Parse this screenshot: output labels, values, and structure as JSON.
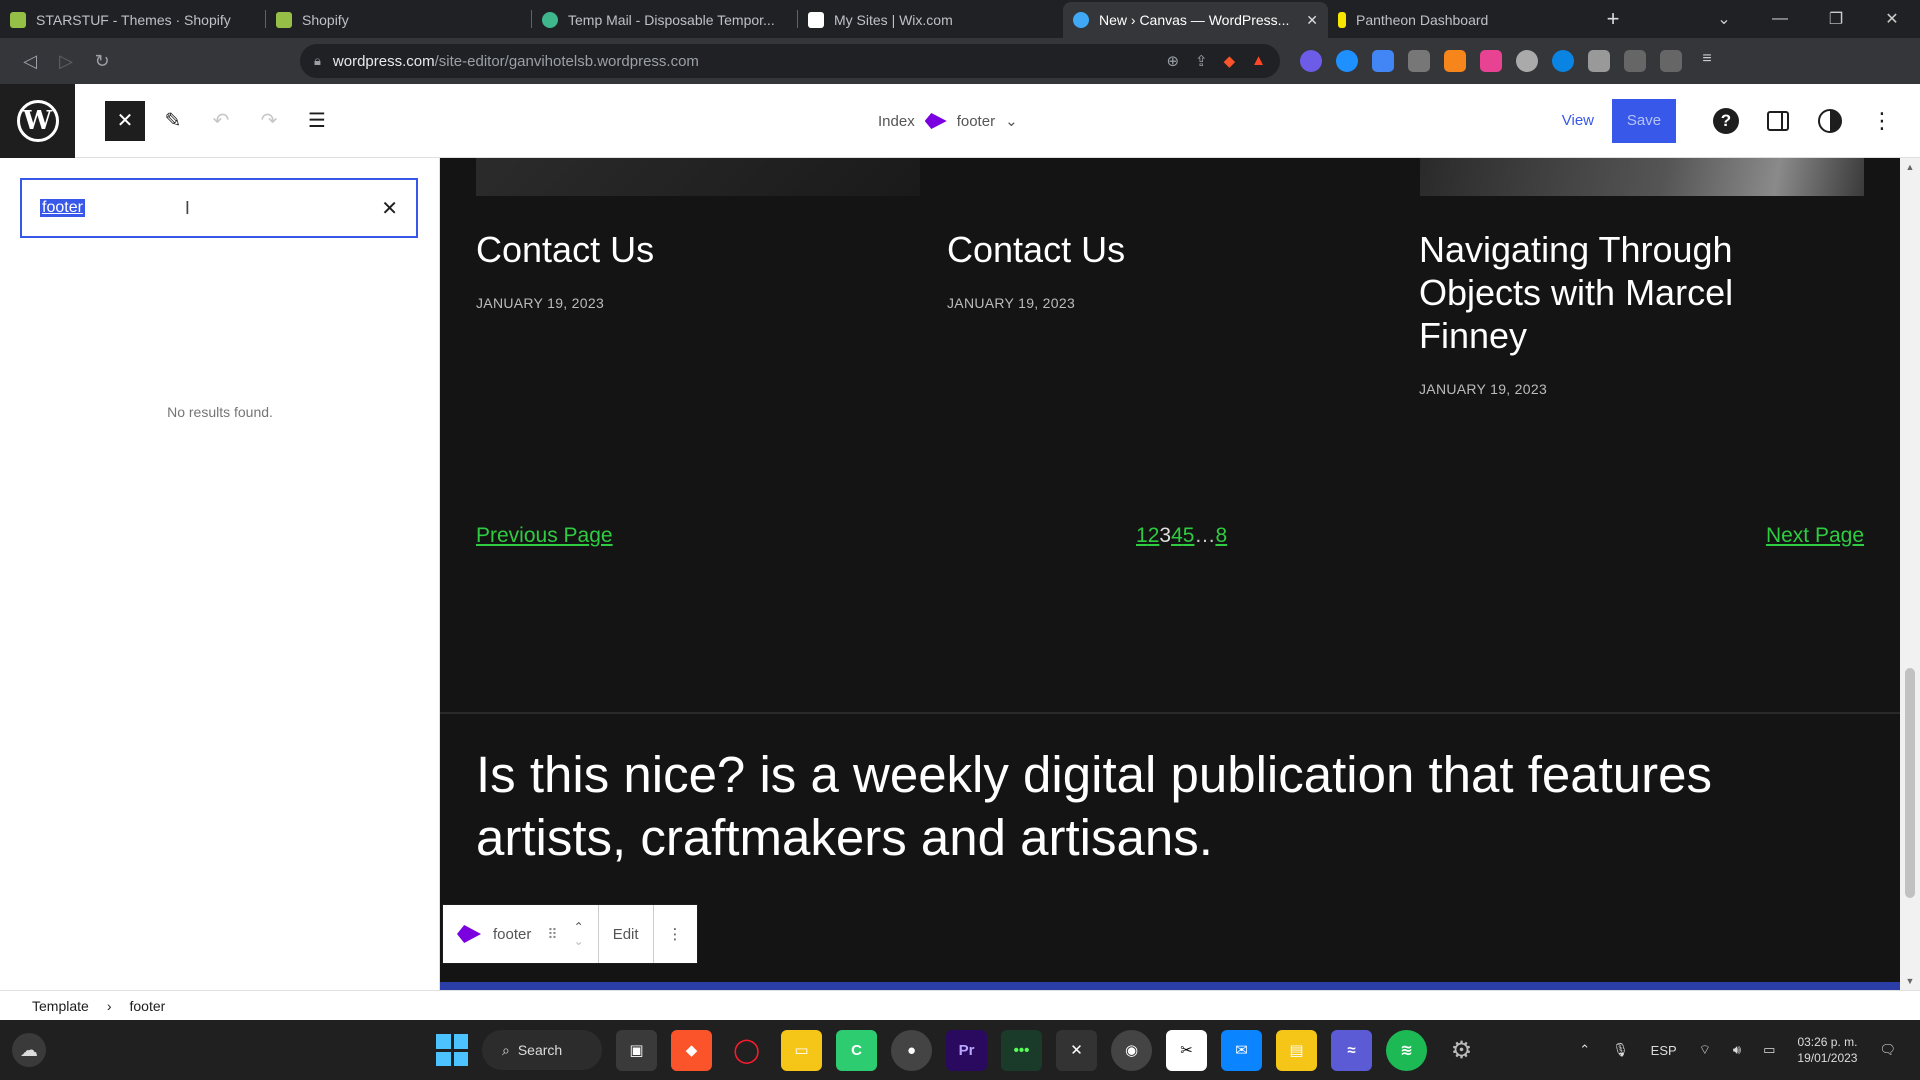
{
  "browser": {
    "tabs": [
      {
        "title": "STARSTUF - Themes · Shopify",
        "color": "#95bf47"
      },
      {
        "title": "Shopify",
        "color": "#95bf47"
      },
      {
        "title": "Temp Mail - Disposable Tempor...",
        "color": "#3fb68b"
      },
      {
        "title": "My Sites | Wix.com",
        "color": "#ffffff"
      },
      {
        "title": "New › Canvas — WordPress...",
        "color": "#3fa9f5"
      },
      {
        "title": "Pantheon Dashboard",
        "color": "#f6e500"
      }
    ],
    "url_domain": "wordpress.com",
    "url_path": "/site-editor/ganvihotelsb.wordpress.com"
  },
  "editor": {
    "doc_prefix": "Index",
    "doc_part": "footer",
    "view_label": "View",
    "save_label": "Save",
    "help_glyph": "?"
  },
  "left_panel": {
    "search_value": "footer",
    "no_results": "No results found."
  },
  "canvas": {
    "posts": [
      {
        "title": "Contact Us",
        "date": "JANUARY 19, 2023"
      },
      {
        "title": "Contact Us",
        "date": "JANUARY 19, 2023"
      },
      {
        "title": "Navigating Through Objects with Marcel Finney",
        "date": "JANUARY 19, 2023"
      }
    ],
    "pagination": {
      "prev": "Previous Page",
      "next": "Next Page",
      "pages": [
        "1",
        "2",
        "3",
        "4",
        "5",
        "…",
        "8"
      ],
      "current_page": "3"
    },
    "tagline": "Is this nice? is a weekly digital publication that features artists, craftmakers and artisans.",
    "accent_link_color": "#2ecc40"
  },
  "block_toolbar": {
    "part_label": "footer",
    "edit_label": "Edit"
  },
  "breadcrumb": {
    "root": "Template",
    "current": "footer"
  },
  "taskbar": {
    "search_label": "Search",
    "lang": "ESP",
    "time": "03:26 p. m.",
    "date": "19/01/2023"
  }
}
